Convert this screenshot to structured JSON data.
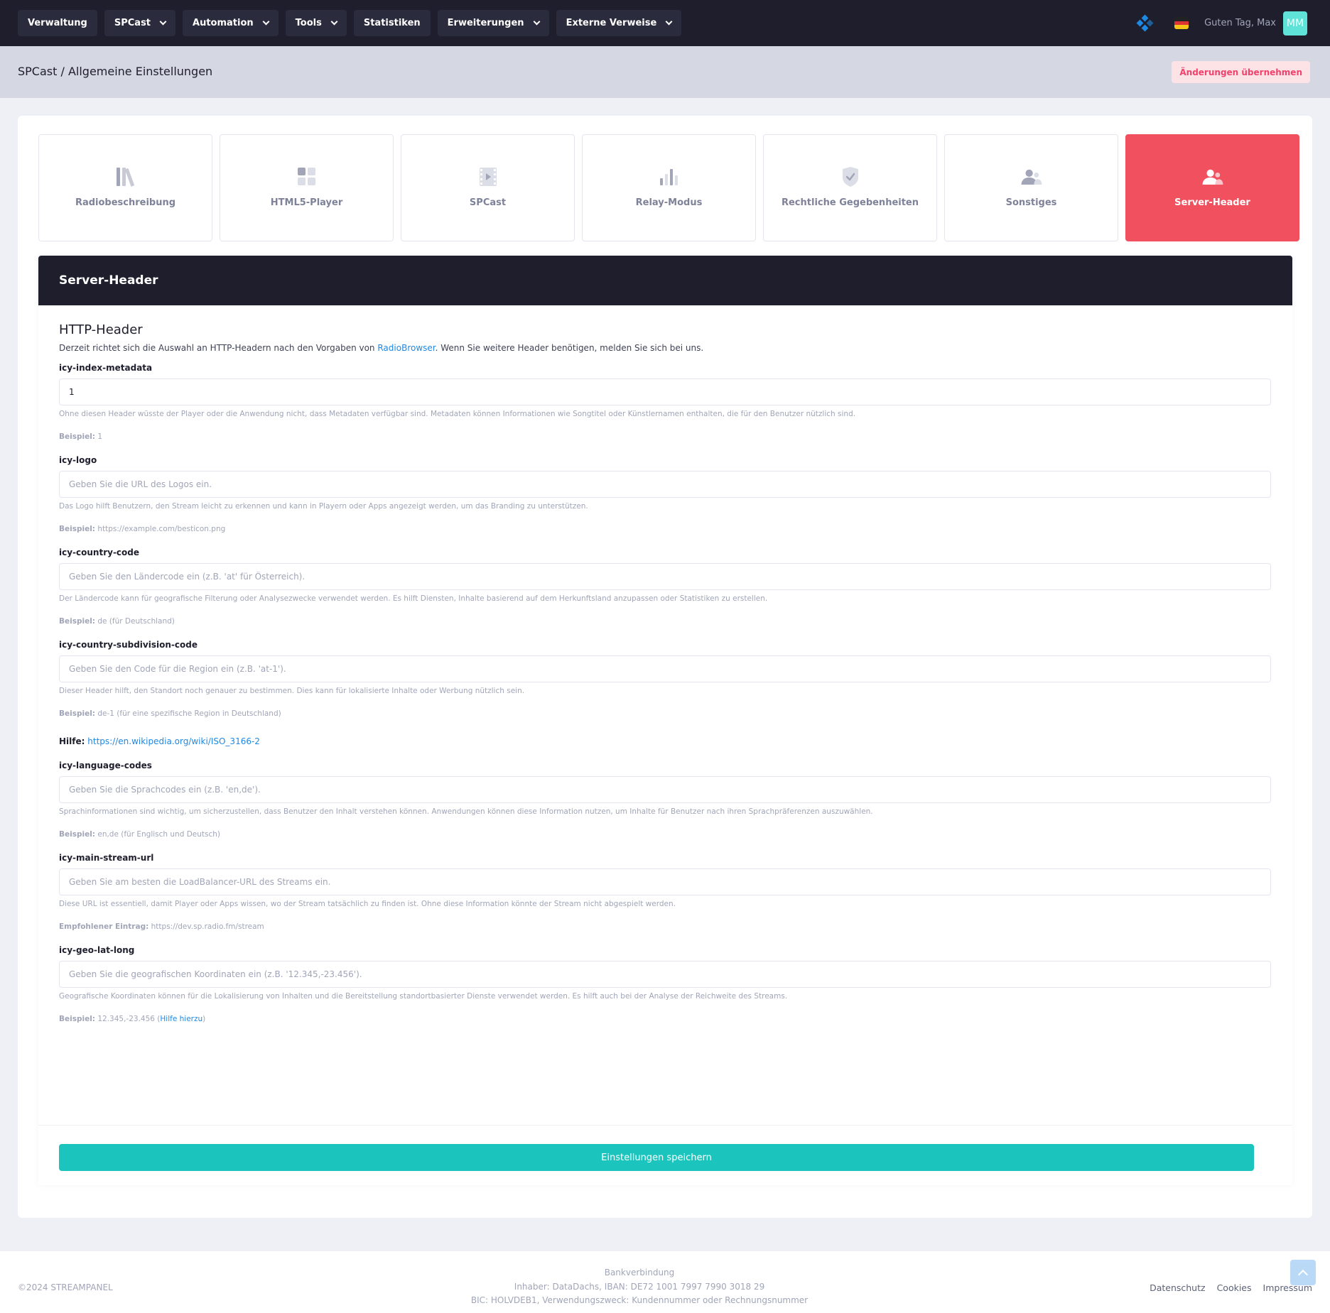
{
  "nav": {
    "items": [
      {
        "label": "Verwaltung",
        "dropdown": false
      },
      {
        "label": "SPCast",
        "dropdown": true
      },
      {
        "label": "Automation",
        "dropdown": true
      },
      {
        "label": "Tools",
        "dropdown": true
      },
      {
        "label": "Statistiken",
        "dropdown": false
      },
      {
        "label": "Erweiterungen",
        "dropdown": true
      },
      {
        "label": "Externe Verweise",
        "dropdown": true
      }
    ],
    "greeting": "Guten Tag, Max",
    "avatar_initials": "MM",
    "language_flag": "de-flag-icon"
  },
  "breadcrumb": "SPCast / Allgemeine Einstellungen",
  "apply_button": "Änderungen übernehmen",
  "tabs": [
    {
      "label": "Radiobeschreibung",
      "icon": "library-icon"
    },
    {
      "label": "HTML5-Player",
      "icon": "grid-icon"
    },
    {
      "label": "SPCast",
      "icon": "video-icon"
    },
    {
      "label": "Relay-Modus",
      "icon": "bar-chart-icon"
    },
    {
      "label": "Rechtliche Gegebenheiten",
      "icon": "shield-check-icon"
    },
    {
      "label": "Sonstiges",
      "icon": "users-icon"
    },
    {
      "label": "Server-Header",
      "icon": "users-icon",
      "active": true
    }
  ],
  "panel": {
    "title": "Server-Header",
    "section_title": "HTTP-Header",
    "desc_before": "Derzeit richtet sich die Auswahl an HTTP-Headern nach den Vorgaben von ",
    "desc_link": "RadioBrowser",
    "desc_after": ". Wenn Sie weitere Header benötigen, melden Sie sich bei uns."
  },
  "fields": {
    "index_metadata": {
      "label": "icy-index-metadata",
      "value": "1",
      "placeholder": "",
      "help": "Ohne diesen Header wüsste der Player oder die Anwendung nicht, dass Metadaten verfügbar sind. Metadaten können Informationen wie Songtitel oder Künstlernamen enthalten, die für den Benutzer nützlich sind.",
      "example_label": "Beispiel:",
      "example": " 1"
    },
    "logo": {
      "label": "icy-logo",
      "placeholder": "Geben Sie die URL des Logos ein.",
      "help": "Das Logo hilft Benutzern, den Stream leicht zu erkennen und kann in Playern oder Apps angezeigt werden, um das Branding zu unterstützen.",
      "example_label": "Beispiel:",
      "example": " https://example.com/besticon.png"
    },
    "country_code": {
      "label": "icy-country-code",
      "placeholder": "Geben Sie den Ländercode ein (z.B. 'at' für Österreich).",
      "help": "Der Ländercode kann für geografische Filterung oder Analysezwecke verwendet werden. Es hilft Diensten, Inhalte basierend auf dem Herkunftsland anzupassen oder Statistiken zu erstellen.",
      "example_label": "Beispiel:",
      "example": " de (für Deutschland)"
    },
    "subdivision_code": {
      "label": "icy-country-subdivision-code",
      "placeholder": "Geben Sie den Code für die Region ein (z.B. 'at-1').",
      "help": "Dieser Header hilft, den Standort noch genauer zu bestimmen. Dies kann für lokalisierte Inhalte oder Werbung nützlich sein.",
      "example_label": "Beispiel:",
      "example": " de-1 (für eine spezifische Region in Deutschland)",
      "hilfe_label": "Hilfe:",
      "hilfe_link": "https://en.wikipedia.org/wiki/ISO_3166-2"
    },
    "language_codes": {
      "label": "icy-language-codes",
      "placeholder": "Geben Sie die Sprachcodes ein (z.B. 'en,de').",
      "help": "Sprachinformationen sind wichtig, um sicherzustellen, dass Benutzer den Inhalt verstehen können. Anwendungen können diese Information nutzen, um Inhalte für Benutzer nach ihren Sprachpräferenzen auszuwählen.",
      "example_label": "Beispiel:",
      "example": " en,de (für Englisch und Deutsch)"
    },
    "main_stream_url": {
      "label": "icy-main-stream-url",
      "placeholder": "Geben Sie am besten die LoadBalancer-URL des Streams ein.",
      "help": "Diese URL ist essentiell, damit Player oder Apps wissen, wo der Stream tatsächlich zu finden ist. Ohne diese Information könnte der Stream nicht abgespielt werden.",
      "example_label": "Empfohlener Eintrag:",
      "example": " https://dev.sp.radio.fm/stream"
    },
    "geo_lat_long": {
      "label": "icy-geo-lat-long",
      "placeholder": "Geben Sie die geografischen Koordinaten ein (z.B. '12.345,-23.456').",
      "help": "Geografische Koordinaten können für die Lokalisierung von Inhalten und die Bereitstellung standortbasierter Dienste verwendet werden. Es hilft auch bei der Analyse der Reichweite des Streams.",
      "example_label": "Beispiel:",
      "example": " 12.345,-23.456 (",
      "example_link": "Hilfe hierzu",
      "example_close": ")"
    }
  },
  "save_button": "Einstellungen speichern",
  "footer": {
    "copyright": "©2024 STREAMPANEL",
    "bank_title": "Bankverbindung",
    "bank_line1": "Inhaber: DataDachs, IBAN: DE72 1001 7997 7990 3018 29",
    "bank_line2": "BIC: HOLVDEB1, Verwendungszweck: Kundennummer oder Rechnungsnummer",
    "links": [
      "Datenschutz",
      "Cookies",
      "Impressum"
    ]
  },
  "colors": {
    "accent": "#f1505f",
    "save": "#1bc5bd",
    "dark": "#1e1e2d"
  }
}
